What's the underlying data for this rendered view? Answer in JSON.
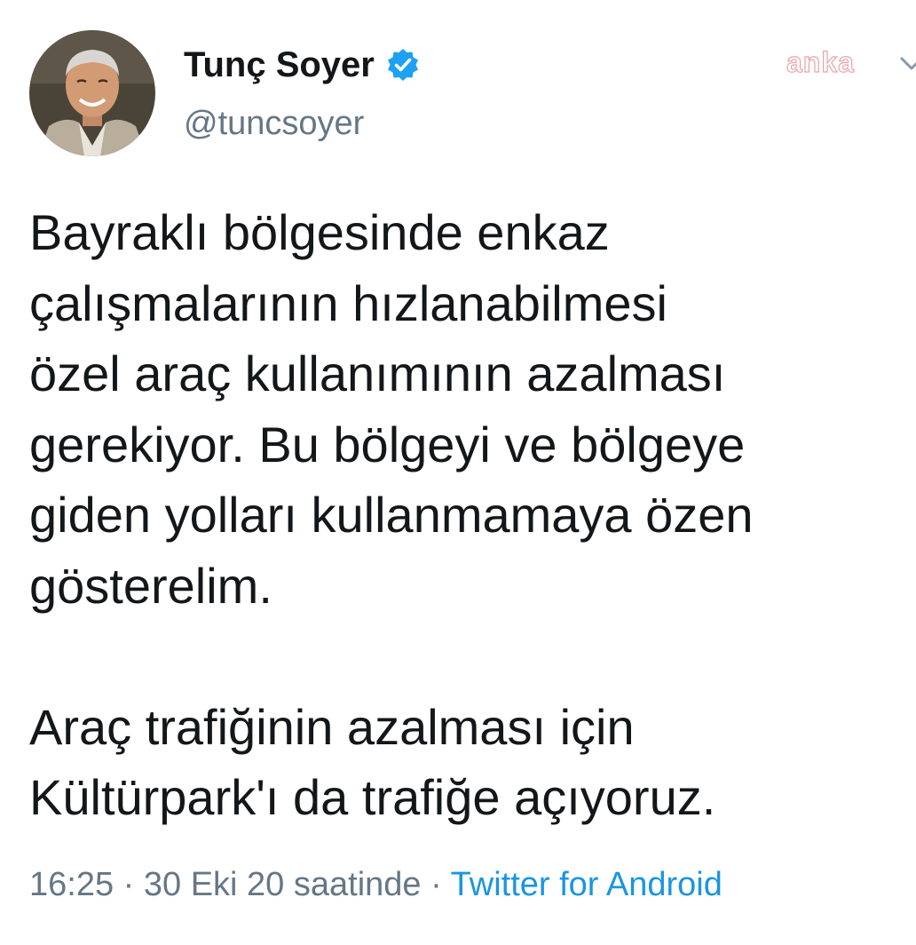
{
  "author": {
    "display_name": "Tunç Soyer",
    "handle": "@tuncsoyer",
    "verified": true,
    "avatar_icon": "profile-photo"
  },
  "watermark": "anka",
  "tweet": {
    "text": "Bayraklı bölgesinde enkaz\nçalışmalarının hızlanabilmesi\nözel araç kullanımının azalması\ngerekiyor. Bu bölgeyi ve bölgeye\ngiden yolları kullanmamaya özen\ngösterelim.\n\nAraç trafiğinin azalması için\nKültürpark'ı da trafiğe açıyoruz."
  },
  "meta": {
    "time": "16:25",
    "separator": " · ",
    "date": "30 Eki 20 saatinde",
    "source": "Twitter for Android"
  },
  "colors": {
    "verified_blue": "#1da1f2",
    "link_blue": "#1b95e0",
    "secondary_gray": "#657786"
  }
}
